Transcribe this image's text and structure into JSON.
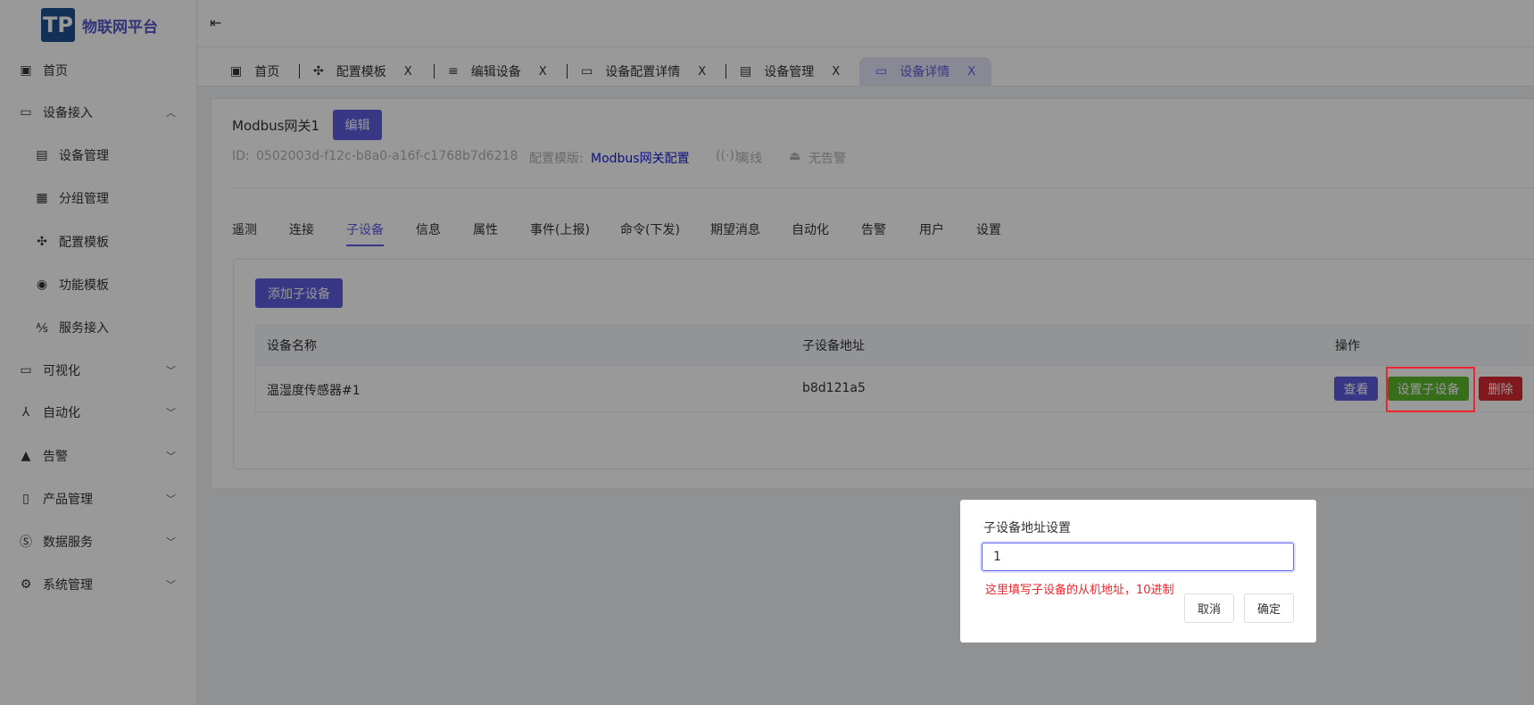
{
  "app": {
    "logo_letters": "TP",
    "title": "物联网平台"
  },
  "sidebar": {
    "items": [
      {
        "label": "首页",
        "icon": "home-f-icon"
      },
      {
        "label": "设备接入",
        "icon": "monitor-icon",
        "expanded": true
      },
      {
        "label": "设备管理",
        "icon": "device-chart-icon",
        "sub": true
      },
      {
        "label": "分组管理",
        "icon": "grid-icon",
        "sub": true
      },
      {
        "label": "配置模板",
        "icon": "puzzle-icon",
        "sub": true
      },
      {
        "label": "功能模板",
        "icon": "circle-icon",
        "sub": true
      },
      {
        "label": "服务接入",
        "icon": "ab-icon",
        "sub": true
      },
      {
        "label": "可视化",
        "icon": "screen-icon"
      },
      {
        "label": "自动化",
        "icon": "nodes-icon"
      },
      {
        "label": "告警",
        "icon": "warning-icon"
      },
      {
        "label": "产品管理",
        "icon": "document-icon"
      },
      {
        "label": "数据服务",
        "icon": "s-icon"
      },
      {
        "label": "系统管理",
        "icon": "settings-monitor-icon"
      }
    ]
  },
  "tabs": [
    {
      "label": "首页",
      "closable": false
    },
    {
      "label": "配置模板",
      "closable": true
    },
    {
      "label": "编辑设备",
      "closable": true
    },
    {
      "label": "设备配置详情",
      "closable": true
    },
    {
      "label": "设备管理",
      "closable": true
    },
    {
      "label": "设备详情",
      "closable": true,
      "active": true
    }
  ],
  "close_glyph": "X",
  "device": {
    "name": "Modbus网关1",
    "edit_label": "编辑",
    "id_label": "ID:",
    "id": "0502003d-f12c-b8a0-a16f-c1768b7d6218",
    "template_label": "配置模版:",
    "template": "Modbus网关配置",
    "status": "离线",
    "alarm": "无告警"
  },
  "detail_tabs": [
    "遥测",
    "连接",
    "子设备",
    "信息",
    "属性",
    "事件(上报)",
    "命令(下发)",
    "期望消息",
    "自动化",
    "告警",
    "用户",
    "设置"
  ],
  "active_detail_tab": "子设备",
  "subdevices": {
    "add_label": "添加子设备",
    "columns": [
      "设备名称",
      "子设备地址",
      "操作"
    ],
    "rows": [
      {
        "name": "温湿度传感器#1",
        "address": "b8d121a5"
      }
    ],
    "actions": {
      "view": "查看",
      "set": "设置子设备",
      "delete": "删除"
    }
  },
  "dialog": {
    "title": "子设备地址设置",
    "value": "1",
    "hint": "这里填写子设备的从机地址，10进制",
    "cancel": "取消",
    "confirm": "确定"
  },
  "colors": {
    "primary": "#5c5ce0",
    "success": "#5cb82a",
    "danger": "#d42a33",
    "highlight": "#f0242c"
  }
}
